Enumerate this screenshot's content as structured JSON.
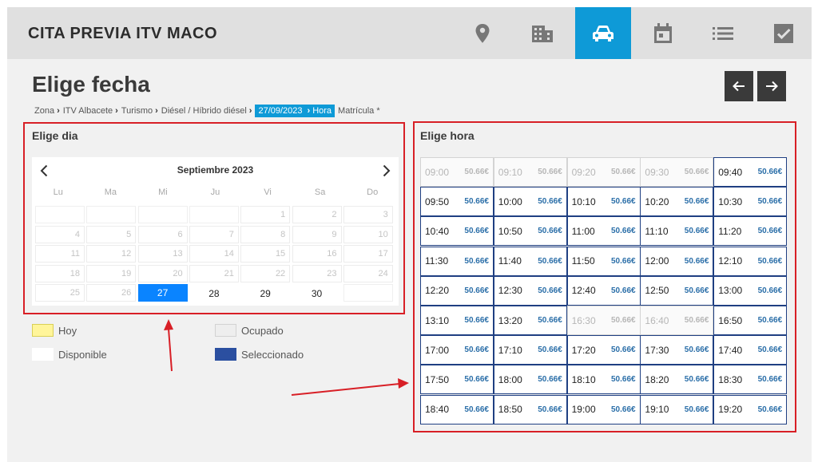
{
  "app": {
    "title": "CITA PREVIA ITV MACO"
  },
  "nav": [
    {
      "icon": "location-pin-icon",
      "active": false
    },
    {
      "icon": "building-icon",
      "active": false
    },
    {
      "icon": "car-icon",
      "active": true
    },
    {
      "icon": "calendar-icon",
      "active": false
    },
    {
      "icon": "list-icon",
      "active": false
    },
    {
      "icon": "checkbox-icon",
      "active": false
    }
  ],
  "page": {
    "title": "Elige fecha"
  },
  "breadcrumb": {
    "items": [
      "Zona",
      "ITV Albacete",
      "Turismo",
      "Diésel / Híbrido diésel"
    ],
    "active_date": "27/09/2023",
    "active_hour": "Hora",
    "last": "Matrícula *"
  },
  "day_panel": {
    "title": "Elige dia"
  },
  "calendar": {
    "month": "Septiembre 2023",
    "weekdays": [
      "Lu",
      "Ma",
      "Mi",
      "Ju",
      "Vi",
      "Sa",
      "Do"
    ],
    "rows": [
      [
        "",
        "",
        "",
        "",
        "1",
        "2",
        "3"
      ],
      [
        "4",
        "5",
        "6",
        "7",
        "8",
        "9",
        "10"
      ],
      [
        "11",
        "12",
        "13",
        "14",
        "15",
        "16",
        "17"
      ],
      [
        "18",
        "19",
        "20",
        "21",
        "22",
        "23",
        "24"
      ],
      [
        "25",
        "26",
        "27",
        "28",
        "29",
        "30",
        ""
      ]
    ],
    "selected": "27",
    "available": [
      "28",
      "29",
      "30"
    ]
  },
  "legend": {
    "today": "Hoy",
    "occupied": "Ocupado",
    "available": "Disponible",
    "selected": "Seleccionado",
    "colors": {
      "today": "#fff59a",
      "occupied": "#eeeeee",
      "available": "#ffffff",
      "selected": "#2b4fa0"
    }
  },
  "hour_panel": {
    "title": "Elige hora"
  },
  "slots": [
    {
      "time": "09:00",
      "price": "50.66€",
      "free": false
    },
    {
      "time": "09:10",
      "price": "50.66€",
      "free": false
    },
    {
      "time": "09:20",
      "price": "50.66€",
      "free": false
    },
    {
      "time": "09:30",
      "price": "50.66€",
      "free": false
    },
    {
      "time": "09:40",
      "price": "50.66€",
      "free": true
    },
    {
      "time": "09:50",
      "price": "50.66€",
      "free": true
    },
    {
      "time": "10:00",
      "price": "50.66€",
      "free": true
    },
    {
      "time": "10:10",
      "price": "50.66€",
      "free": true
    },
    {
      "time": "10:20",
      "price": "50.66€",
      "free": true
    },
    {
      "time": "10:30",
      "price": "50.66€",
      "free": true
    },
    {
      "time": "10:40",
      "price": "50.66€",
      "free": true
    },
    {
      "time": "10:50",
      "price": "50.66€",
      "free": true
    },
    {
      "time": "11:00",
      "price": "50.66€",
      "free": true
    },
    {
      "time": "11:10",
      "price": "50.66€",
      "free": true
    },
    {
      "time": "11:20",
      "price": "50.66€",
      "free": true
    },
    {
      "time": "11:30",
      "price": "50.66€",
      "free": true
    },
    {
      "time": "11:40",
      "price": "50.66€",
      "free": true
    },
    {
      "time": "11:50",
      "price": "50.66€",
      "free": true
    },
    {
      "time": "12:00",
      "price": "50.66€",
      "free": true
    },
    {
      "time": "12:10",
      "price": "50.66€",
      "free": true
    },
    {
      "time": "12:20",
      "price": "50.66€",
      "free": true
    },
    {
      "time": "12:30",
      "price": "50.66€",
      "free": true
    },
    {
      "time": "12:40",
      "price": "50.66€",
      "free": true
    },
    {
      "time": "12:50",
      "price": "50.66€",
      "free": true
    },
    {
      "time": "13:00",
      "price": "50.66€",
      "free": true
    },
    {
      "time": "13:10",
      "price": "50.66€",
      "free": true
    },
    {
      "time": "13:20",
      "price": "50.66€",
      "free": true
    },
    {
      "time": "16:30",
      "price": "50.66€",
      "free": false
    },
    {
      "time": "16:40",
      "price": "50.66€",
      "free": false
    },
    {
      "time": "16:50",
      "price": "50.66€",
      "free": true
    },
    {
      "time": "17:00",
      "price": "50.66€",
      "free": true
    },
    {
      "time": "17:10",
      "price": "50.66€",
      "free": true
    },
    {
      "time": "17:20",
      "price": "50.66€",
      "free": true
    },
    {
      "time": "17:30",
      "price": "50.66€",
      "free": true
    },
    {
      "time": "17:40",
      "price": "50.66€",
      "free": true
    },
    {
      "time": "17:50",
      "price": "50.66€",
      "free": true
    },
    {
      "time": "18:00",
      "price": "50.66€",
      "free": true
    },
    {
      "time": "18:10",
      "price": "50.66€",
      "free": true
    },
    {
      "time": "18:20",
      "price": "50.66€",
      "free": true
    },
    {
      "time": "18:30",
      "price": "50.66€",
      "free": true
    },
    {
      "time": "18:40",
      "price": "50.66€",
      "free": true
    },
    {
      "time": "18:50",
      "price": "50.66€",
      "free": true
    },
    {
      "time": "19:00",
      "price": "50.66€",
      "free": true
    },
    {
      "time": "19:10",
      "price": "50.66€",
      "free": true
    },
    {
      "time": "19:20",
      "price": "50.66€",
      "free": true
    }
  ],
  "colors": {
    "accent": "#0e9ad7",
    "annotation": "#d81f26",
    "slot_border": "#1f3f82",
    "price": "#2a6ea8",
    "selected_day": "#0a84ff"
  }
}
